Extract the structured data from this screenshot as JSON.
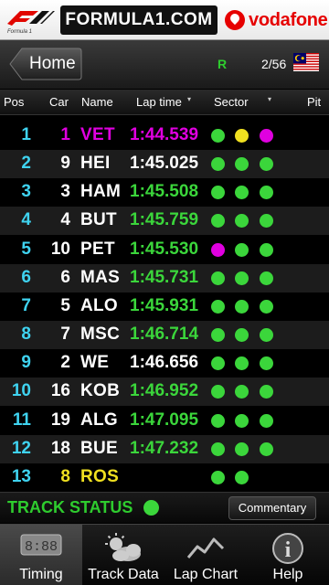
{
  "brand": {
    "site": "FORMULA1.COM",
    "sponsor": "vodafone",
    "logo_tagline": "Formula 1"
  },
  "nav": {
    "home_label": "Home",
    "session": "R",
    "lap_count": "2/56"
  },
  "columns": {
    "pos": "Pos",
    "car": "Car",
    "name": "Name",
    "lap_time": "Lap time",
    "sector": "Sector",
    "pit": "Pit"
  },
  "colors": {
    "green": "#3bd63b",
    "yellow": "#f0e020",
    "purple": "#e000e0",
    "white": "#ffffff",
    "cyan": "#3fd3f0",
    "lap_green": "#3bd63b"
  },
  "rows": [
    {
      "pos": "1",
      "car": "1",
      "name": "VET",
      "lap": "1:44.539",
      "car_color": "purple",
      "name_color": "purple",
      "lap_color": "purple",
      "sectors": [
        "green",
        "yellow",
        "purple"
      ]
    },
    {
      "pos": "2",
      "car": "9",
      "name": "HEI",
      "lap": "1:45.025",
      "car_color": "white",
      "name_color": "white",
      "lap_color": "white",
      "sectors": [
        "green",
        "green",
        "green"
      ]
    },
    {
      "pos": "3",
      "car": "3",
      "name": "HAM",
      "lap": "1:45.508",
      "car_color": "white",
      "name_color": "white",
      "lap_color": "lap_green",
      "sectors": [
        "green",
        "green",
        "green"
      ]
    },
    {
      "pos": "4",
      "car": "4",
      "name": "BUT",
      "lap": "1:45.759",
      "car_color": "white",
      "name_color": "white",
      "lap_color": "lap_green",
      "sectors": [
        "green",
        "green",
        "green"
      ]
    },
    {
      "pos": "5",
      "car": "10",
      "name": "PET",
      "lap": "1:45.530",
      "car_color": "white",
      "name_color": "white",
      "lap_color": "lap_green",
      "sectors": [
        "purple",
        "green",
        "green"
      ]
    },
    {
      "pos": "6",
      "car": "6",
      "name": "MAS",
      "lap": "1:45.731",
      "car_color": "white",
      "name_color": "white",
      "lap_color": "lap_green",
      "sectors": [
        "green",
        "green",
        "green"
      ]
    },
    {
      "pos": "7",
      "car": "5",
      "name": "ALO",
      "lap": "1:45.931",
      "car_color": "white",
      "name_color": "white",
      "lap_color": "lap_green",
      "sectors": [
        "green",
        "green",
        "green"
      ]
    },
    {
      "pos": "8",
      "car": "7",
      "name": "MSC",
      "lap": "1:46.714",
      "car_color": "white",
      "name_color": "white",
      "lap_color": "lap_green",
      "sectors": [
        "green",
        "green",
        "green"
      ]
    },
    {
      "pos": "9",
      "car": "2",
      "name": "WE",
      "lap": "1:46.656",
      "car_color": "white",
      "name_color": "white",
      "lap_color": "white",
      "sectors": [
        "green",
        "green",
        "green"
      ]
    },
    {
      "pos": "10",
      "car": "16",
      "name": "KOB",
      "lap": "1:46.952",
      "car_color": "white",
      "name_color": "white",
      "lap_color": "lap_green",
      "sectors": [
        "green",
        "green",
        "green"
      ]
    },
    {
      "pos": "11",
      "car": "19",
      "name": "ALG",
      "lap": "1:47.095",
      "car_color": "white",
      "name_color": "white",
      "lap_color": "lap_green",
      "sectors": [
        "green",
        "green",
        "green"
      ]
    },
    {
      "pos": "12",
      "car": "18",
      "name": "BUE",
      "lap": "1:47.232",
      "car_color": "white",
      "name_color": "white",
      "lap_color": "lap_green",
      "sectors": [
        "green",
        "green",
        "green"
      ]
    },
    {
      "pos": "13",
      "car": "8",
      "name": "ROS",
      "lap": "",
      "car_color": "yellow",
      "name_color": "yellow",
      "lap_color": "white",
      "sectors": [
        "green",
        "green"
      ]
    }
  ],
  "track_status": {
    "label": "TRACK STATUS",
    "color": "green",
    "commentary_label": "Commentary"
  },
  "tabs": [
    {
      "label": "Timing",
      "icon": "timing-icon",
      "active": true,
      "icon_text": "8:88"
    },
    {
      "label": "Track Data",
      "icon": "weather-icon",
      "active": false
    },
    {
      "label": "Lap Chart",
      "icon": "lap-chart-icon",
      "active": false
    },
    {
      "label": "Help",
      "icon": "help-icon",
      "active": false,
      "icon_text": "i"
    }
  ]
}
